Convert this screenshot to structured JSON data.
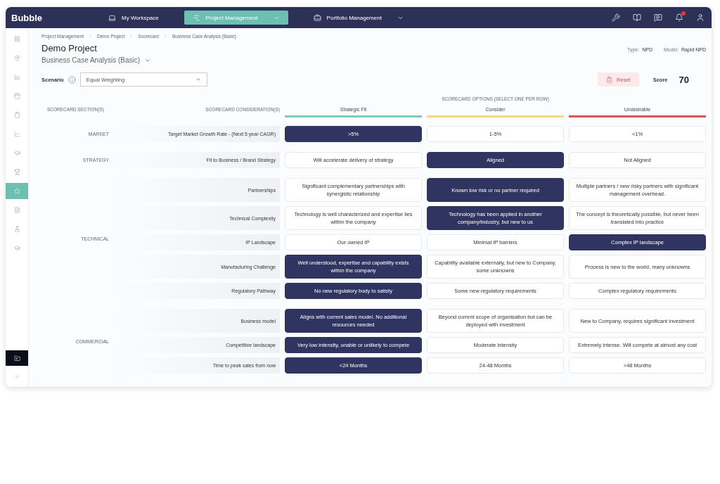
{
  "app": {
    "logo": "Bubble"
  },
  "nav": [
    {
      "label": "My Workspace",
      "selected": false,
      "dropdown": false
    },
    {
      "label": "Project Management",
      "selected": true,
      "dropdown": true
    },
    {
      "label": "Portfolio Management",
      "selected": false,
      "dropdown": true
    }
  ],
  "toolbar": {
    "notifications_badge": true
  },
  "sidebar": {
    "items": [
      {
        "selected": false
      },
      {
        "selected": false
      },
      {
        "selected": false
      },
      {
        "selected": false
      },
      {
        "selected": false
      },
      {
        "selected": false
      },
      {
        "selected": false
      },
      {
        "selected": false
      },
      {
        "selected": true
      },
      {
        "selected": false
      },
      {
        "selected": false
      },
      {
        "selected": false
      }
    ]
  },
  "breadcrumb": [
    "Project Management",
    "Demo Project",
    "Scorecard",
    "Business Case Analysis (Basic)"
  ],
  "title": "Demo Project",
  "subtitle": "Business Case Analysis (Basic)",
  "meta": [
    {
      "label": "Type:",
      "value": "NPD"
    },
    {
      "label": "Model:",
      "value": "Rapid NPD"
    }
  ],
  "scenario": {
    "label": "Scenario",
    "value": "Equal Weighting"
  },
  "reset_button": "Reset",
  "score": {
    "label": "Score",
    "value": "70"
  },
  "table": {
    "section_heading": "SCORECARD SECTION(S)",
    "consideration_heading": "SCORECARD CONSIDERATION(S)",
    "options_heading": "SCORECARD OPTIONS (SELECT ONE PER ROW)",
    "columns": [
      {
        "label": "Strategic Fit",
        "color": "#7fcbb3"
      },
      {
        "label": "Consider",
        "color": "#f2dc7a"
      },
      {
        "label": "Undesirable",
        "color": "#d9545a"
      }
    ],
    "sections": [
      {
        "name": "MARKET",
        "rows": [
          {
            "consideration": "Target Market Growth Rate - (Next 5 year CAGR)",
            "options": [
              {
                "text": ">5%",
                "selected": true
              },
              {
                "text": "1-5%",
                "selected": false
              },
              {
                "text": "<1%",
                "selected": false
              }
            ]
          }
        ]
      },
      {
        "name": "STRATEGY",
        "rows": [
          {
            "consideration": "Fit to Business / Brand Strategy",
            "options": [
              {
                "text": "Will accelerate delivery of strategy",
                "selected": false
              },
              {
                "text": "Aligned",
                "selected": true
              },
              {
                "text": "Not Aligned",
                "selected": false
              }
            ]
          }
        ]
      },
      {
        "name": "TECHNICAL",
        "rows": [
          {
            "consideration": "Partnerships",
            "options": [
              {
                "text": "Significant complementary partnerships with synergistic relationship",
                "selected": false
              },
              {
                "text": "Known low risk or no partner required",
                "selected": true
              },
              {
                "text": "Multiple partners / new risky partners with significant management overhead.",
                "selected": false
              }
            ]
          },
          {
            "consideration": "Technical Complexity",
            "options": [
              {
                "text": "Technology is well characterized and expertise lies within the company",
                "selected": false
              },
              {
                "text": "Technology has been applied in another company/industry, but new to us",
                "selected": true
              },
              {
                "text": "The concept is theoretically possible, but never been translated into practice",
                "selected": false
              }
            ]
          },
          {
            "consideration": "IP Landscape",
            "options": [
              {
                "text": "Our owned IP",
                "selected": false
              },
              {
                "text": "Minimal IP barriers",
                "selected": false
              },
              {
                "text": "Complex IP landscape",
                "selected": true
              }
            ]
          },
          {
            "consideration": "Manufacturing Challenge",
            "options": [
              {
                "text": "Well understood, expertise and capability exists within the company",
                "selected": true
              },
              {
                "text": "Capability available externally, but new to Company, some unknowns",
                "selected": false
              },
              {
                "text": "Process is new to the world, many unknowns",
                "selected": false
              }
            ]
          },
          {
            "consideration": "Regulatory Pathway",
            "options": [
              {
                "text": "No new regulatory body to satisfy",
                "selected": true
              },
              {
                "text": "Some new regulatory requirements",
                "selected": false
              },
              {
                "text": "Complex regulatory requirements",
                "selected": false
              }
            ]
          }
        ]
      },
      {
        "name": "COMMERCIAL",
        "rows": [
          {
            "consideration": "Business model",
            "options": [
              {
                "text": "Aligns with current sales model. No additional resources needed",
                "selected": true
              },
              {
                "text": "Beyond current scope of organisation but can be deployed with investment",
                "selected": false
              },
              {
                "text": "New to Company, requires significant investment",
                "selected": false
              }
            ]
          },
          {
            "consideration": "Competitive landscape",
            "options": [
              {
                "text": "Very low intensity, unable or unlikely to compete",
                "selected": true
              },
              {
                "text": "Moderate intensity",
                "selected": false
              },
              {
                "text": "Extremely intense. Will compete at almost any cost",
                "selected": false
              }
            ]
          },
          {
            "consideration": "Time to peak sales from now",
            "options": [
              {
                "text": "<24 Months",
                "selected": true
              },
              {
                "text": "24-48 Months",
                "selected": false
              },
              {
                "text": ">48 Months",
                "selected": false
              }
            ]
          }
        ]
      }
    ]
  }
}
